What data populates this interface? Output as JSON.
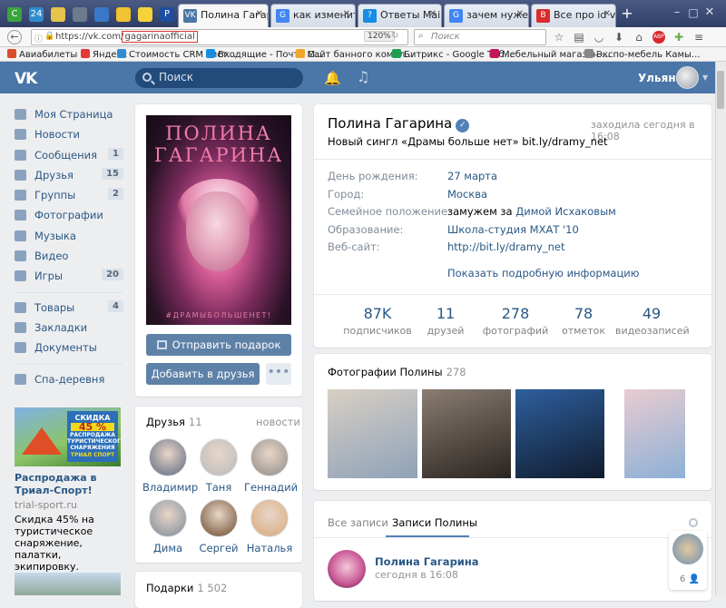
{
  "browser": {
    "pinned_tabs": [
      {
        "icon": "leaf-icon",
        "label": "С",
        "color": "#3aa53d"
      },
      {
        "icon": "24-icon",
        "label": "24",
        "color": "#2f8ccf"
      },
      {
        "icon": "note-icon",
        "label": "",
        "color": "#e6c34b"
      },
      {
        "icon": "circle-icon",
        "label": "",
        "color": "#6c7b8c"
      },
      {
        "icon": "globe-icon",
        "label": "",
        "color": "#3978c7"
      },
      {
        "icon": "yellow-doc-icon",
        "label": "",
        "color": "#f1c232"
      },
      {
        "icon": "bulb-icon",
        "label": "",
        "color": "#f7d33b"
      },
      {
        "icon": "paypal-icon",
        "label": "P",
        "color": "#1e4ea0"
      }
    ],
    "tabs": [
      {
        "title": "Полина Гагарина",
        "favicon": "VK",
        "color": "#4a76a8",
        "active": true
      },
      {
        "title": "как изменить id",
        "favicon": "G",
        "color": "#4285f4",
        "active": false
      },
      {
        "title": "Ответы Mail.Ru:",
        "favicon": "?",
        "color": "#168de2",
        "active": false
      },
      {
        "title": "зачем нужен id",
        "favicon": "G",
        "color": "#4285f4",
        "active": false
      },
      {
        "title": "Все про id vkont",
        "favicon": "В",
        "color": "#d92b2b",
        "active": false
      }
    ],
    "new_tab": "+",
    "url_host": "https://vk.com/",
    "url_path": "gagarinaofficial",
    "zoom": "120%",
    "search_placeholder": "Поиск",
    "bookmarks": [
      {
        "label": "Авиабилеты",
        "color": "#d94f2b"
      },
      {
        "label": "Яндекс",
        "color": "#e53935"
      },
      {
        "label": "Стоимость CRM сист...",
        "color": "#2f8ccf",
        "prefix": "24"
      },
      {
        "label": "Входящие - Почта M...",
        "color": "#168de2"
      },
      {
        "label": "Сайт банного компл...",
        "color": "#f2a72b"
      },
      {
        "label": "Битрикс - Google Таб...",
        "color": "#1e9e51"
      },
      {
        "label": "Мебельный магазин ...",
        "color": "#c2185b"
      },
      {
        "label": "Экспо-мебель Камы...",
        "color": "#888888"
      }
    ]
  },
  "vk": {
    "search_placeholder": "Поиск",
    "user_name": "Ульяна",
    "left_nav": [
      {
        "label": "Моя Страница",
        "icon": "home-icon",
        "count": ""
      },
      {
        "label": "Новости",
        "icon": "news-icon",
        "count": ""
      },
      {
        "label": "Сообщения",
        "icon": "messages-icon",
        "count": "1"
      },
      {
        "label": "Друзья",
        "icon": "friends-icon",
        "count": "15"
      },
      {
        "label": "Группы",
        "icon": "groups-icon",
        "count": "2"
      },
      {
        "label": "Фотографии",
        "icon": "camera-icon",
        "count": ""
      },
      {
        "label": "Музыка",
        "icon": "music-icon",
        "count": ""
      },
      {
        "label": "Видео",
        "icon": "video-icon",
        "count": ""
      },
      {
        "label": "Игры",
        "icon": "games-icon",
        "count": "20"
      }
    ],
    "left_nav2": [
      {
        "label": "Товары",
        "icon": "goods-icon",
        "count": "4"
      },
      {
        "label": "Закладки",
        "icon": "star-icon",
        "count": ""
      },
      {
        "label": "Документы",
        "icon": "documents-icon",
        "count": ""
      }
    ],
    "left_nav3": [
      {
        "label": "Спа-деревня",
        "icon": "group-icon",
        "count": ""
      }
    ],
    "ad": {
      "banner_line1": "СКИДКА",
      "banner_line2": "45 %",
      "banner_line3": "РАСПРОДАЖА ТУРИСТИЧЕСКОГО СНАРЯЖЕНИЯ",
      "banner_brand": "ТРИАЛ СПОРТ",
      "title": "Распродажа в Триал-Спорт!",
      "domain": "trial-sport.ru",
      "text": "Скидка 45% на туристическое снаряжение, палатки, экипировку."
    },
    "profile": {
      "photo_title_line1": "ПОЛИНА",
      "photo_title_line2": "ГАГАРИНА",
      "photo_hashtag": "#ДРАМЫБОЛЬШЕНЕТ!",
      "gift_button": "Отправить подарок",
      "add_friend_button": "Добавить в друзья",
      "more_button": "•••",
      "name": "Полина Гагарина",
      "last_seen": "заходила сегодня в 16:08",
      "status": "Новый сингл «Драмы больше нет» bit.ly/dramy_net",
      "info": [
        {
          "label": "День рождения:",
          "value": "27 марта"
        },
        {
          "label": "Город:",
          "value": "Москва"
        },
        {
          "label": "Семейное положение:",
          "value_plain": "замужем за",
          "value": "Димой Исхаковым"
        },
        {
          "label": "Образование:",
          "value": "Школа-студия МХАТ '10"
        },
        {
          "label": "Веб-сайт:",
          "value": "http://bit.ly/dramy_net"
        }
      ],
      "more_info": "Показать подробную информацию",
      "stats": [
        {
          "num": "87K",
          "label": "подписчиков"
        },
        {
          "num": "11",
          "label": "друзей"
        },
        {
          "num": "278",
          "label": "фотографий"
        },
        {
          "num": "78",
          "label": "отметок"
        },
        {
          "num": "49",
          "label": "видеозаписей"
        }
      ]
    },
    "friends": {
      "title": "Друзья",
      "count": "11",
      "news_link": "новости",
      "list": [
        {
          "name": "Владимир",
          "color": "#5a6780"
        },
        {
          "name": "Таня",
          "color": "#b9b9b9"
        },
        {
          "name": "Геннадий",
          "color": "#8f8a86"
        },
        {
          "name": "Дима",
          "color": "#7c8a9a"
        },
        {
          "name": "Сергей",
          "color": "#6b4a2b"
        },
        {
          "name": "Наталья",
          "color": "#d9a87a"
        }
      ]
    },
    "gifts": {
      "title": "Подарки",
      "count": "1 502"
    },
    "photos": {
      "title": "Фотографии Полины",
      "count": "278",
      "thumbs": [
        {
          "color1": "#d8cfc4",
          "color2": "#8fa2b8"
        },
        {
          "color1": "#8a7d72",
          "color2": "#2a2420"
        },
        {
          "color1": "#2e5f9e",
          "color2": "#101c2e"
        },
        {
          "color1": "#e8ccd0",
          "color2": "#8db0d6"
        }
      ]
    },
    "wall": {
      "tab_all": "Все записи",
      "tab_own": "Записи Полины",
      "post_author": "Полина Гагарина",
      "post_date": "сегодня в 16:08"
    },
    "chat_widget": {
      "count": "6"
    }
  }
}
